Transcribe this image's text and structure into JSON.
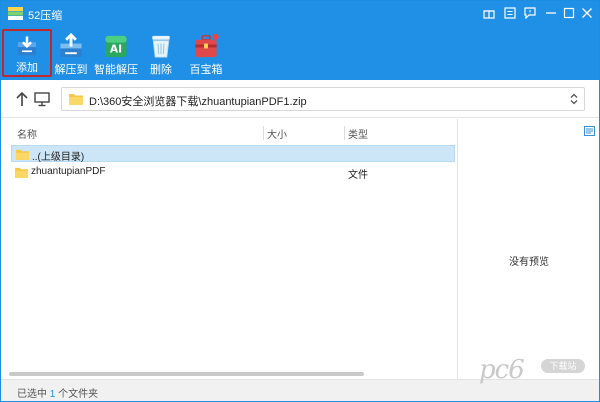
{
  "app": {
    "title": "52压缩",
    "accent": "#1f90e6"
  },
  "titlebar": {
    "buttons": [
      "gift-icon",
      "menu-icon",
      "feedback-icon",
      "minimize-icon",
      "maximize-icon",
      "close-icon"
    ]
  },
  "toolbar": {
    "items": [
      {
        "label": "添加",
        "icon": "add-archive-icon",
        "active": true
      },
      {
        "label": "解压到",
        "icon": "extract-to-icon"
      },
      {
        "label": "智能解压",
        "icon": "smart-extract-icon"
      },
      {
        "label": "删除",
        "icon": "delete-icon"
      },
      {
        "label": "百宝箱",
        "icon": "toolbox-icon"
      }
    ]
  },
  "address": {
    "path": "D:\\360安全浏览器下载\\zhuantupianPDF1.zip"
  },
  "columns": {
    "name": "名称",
    "size": "大小",
    "type": "类型"
  },
  "rows": [
    {
      "name": "..(上级目录)",
      "type": "",
      "selected": true
    },
    {
      "name": "zhuantupianPDF",
      "type": "文件",
      "selected": false
    }
  ],
  "preview": {
    "empty_text": "没有预览"
  },
  "status": {
    "prefix": "已选中",
    "count": "1",
    "suffix": "个文件夹"
  },
  "watermark": {
    "brand": "pc6",
    "badge": "下载站"
  }
}
